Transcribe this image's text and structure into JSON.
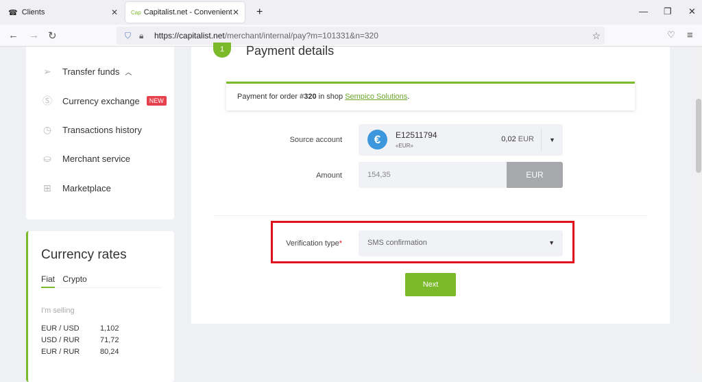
{
  "browser": {
    "tabs": [
      {
        "label": "Clients"
      },
      {
        "label": "Capitalist.net - Convenient onli",
        "favicon": "Cap"
      }
    ],
    "url_host": "https://capitalist.net",
    "url_path": "/merchant/internal/pay?m=101331&n=320"
  },
  "sidebar": {
    "items": [
      {
        "label": "Transfer funds",
        "icon": "paper-plane-icon"
      },
      {
        "label": "Currency exchange",
        "badge": "NEW",
        "icon": "dollar-circle-icon"
      },
      {
        "label": "Transactions history",
        "icon": "clock-icon"
      },
      {
        "label": "Merchant service",
        "icon": "merchant-icon"
      },
      {
        "label": "Marketplace",
        "icon": "grid-plus-icon"
      }
    ]
  },
  "rates": {
    "title": "Currency rates",
    "tabs": [
      "Fiat",
      "Crypto"
    ],
    "subtitle": "I'm selling",
    "rows": [
      {
        "pair": "EUR / USD",
        "value": "1,102"
      },
      {
        "pair": "USD / RUR",
        "value": "71,72"
      },
      {
        "pair": "EUR / RUR",
        "value": "80,24"
      }
    ]
  },
  "main": {
    "step": "1",
    "title": "Payment details",
    "notice": {
      "prefix": "Payment for order #",
      "order": "320",
      "mid": " in shop ",
      "shop": "Sempico Solutions",
      "suffix": "."
    },
    "source_label": "Source account",
    "account": "E12511794",
    "account_cur": "«EUR»",
    "balance": "0,02",
    "balance_cur": "EUR",
    "amount_label": "Amount",
    "amount": "154,35",
    "amount_cur": "EUR",
    "verification_label": "Verification type",
    "required": "*",
    "verification_value": "SMS confirmation",
    "next": "Next"
  },
  "colors": {
    "accent": "#7ab929",
    "highlight": "#e0101c"
  }
}
